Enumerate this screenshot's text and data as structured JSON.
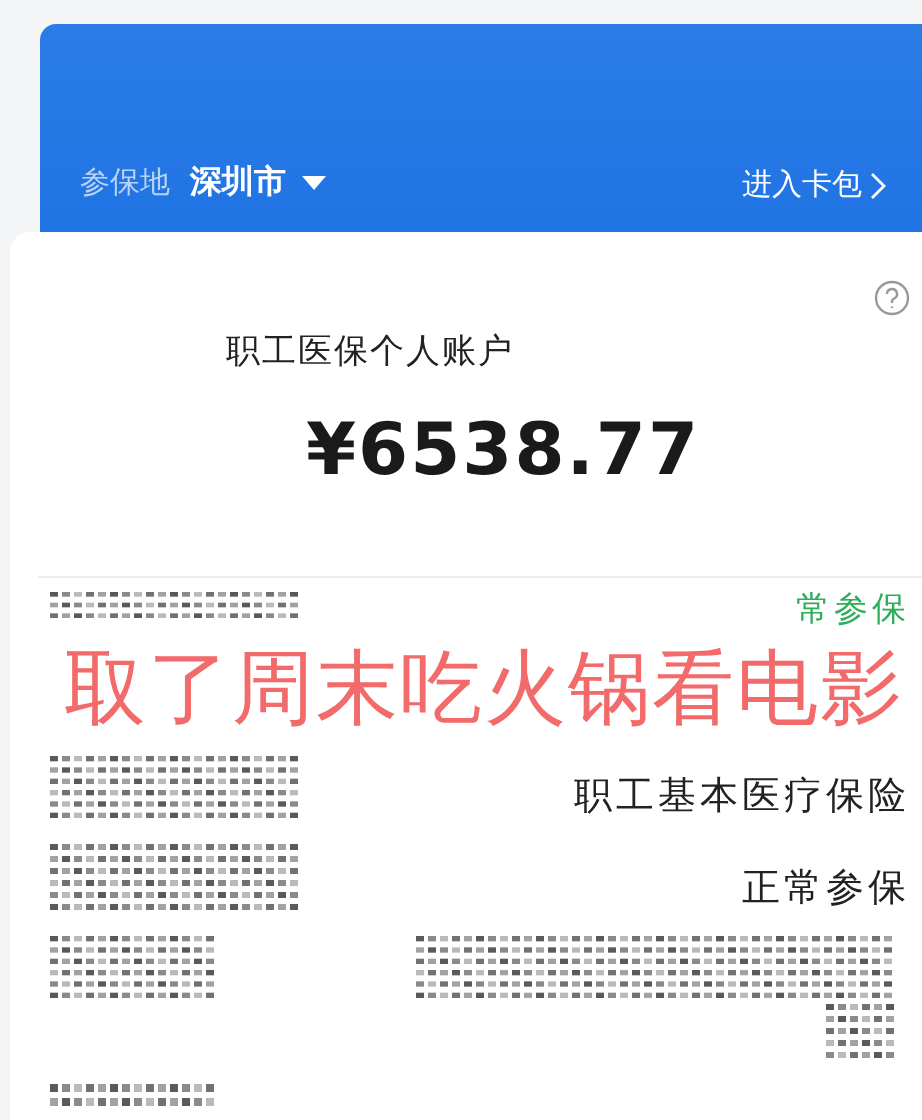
{
  "header": {
    "region_label": "参保地",
    "city": "深圳市",
    "card_link": "进入卡包"
  },
  "account": {
    "title": "职工医保个人账户",
    "balance": "¥6538.77"
  },
  "overlay_caption": "取了周末吃火锅看电影",
  "details": {
    "status_top": "常参保",
    "insurance_type": "职工基本医疗保险",
    "status": "正常参保"
  }
}
